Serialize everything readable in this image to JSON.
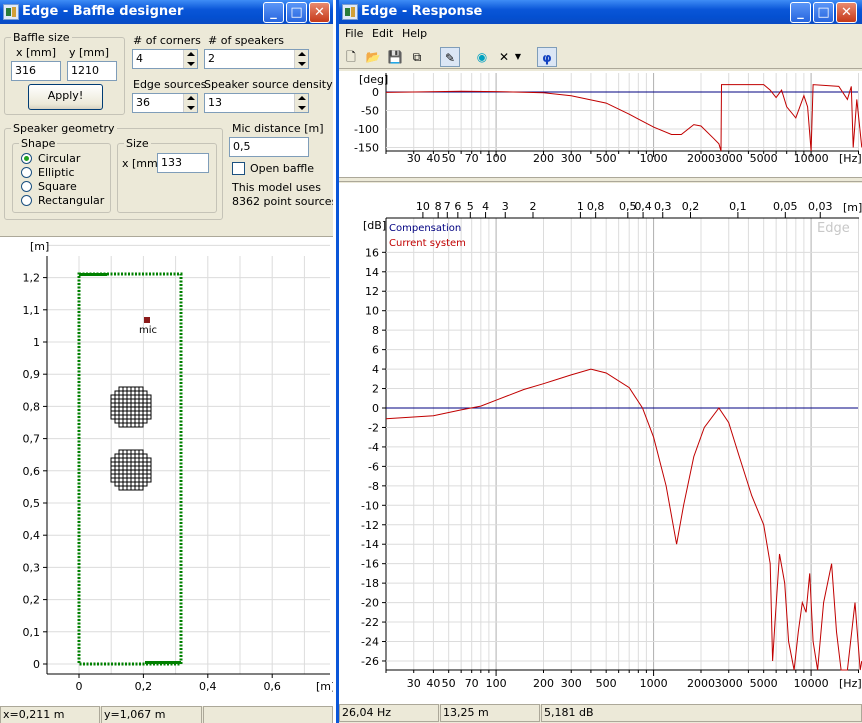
{
  "baffle_window": {
    "title": "Edge - Baffle designer",
    "baffle_size": {
      "group_label": "Baffle size",
      "x_label": "x [mm]",
      "y_label": "y [mm]",
      "x_value": "316",
      "y_value": "1210",
      "apply_label": "Apply!"
    },
    "corners": {
      "label": "# of corners",
      "value": "4"
    },
    "speakers": {
      "label": "# of speakers",
      "value": "2"
    },
    "edge_sources": {
      "label": "Edge sources",
      "value": "36"
    },
    "density": {
      "label": "Speaker source density",
      "value": "13"
    },
    "geometry": {
      "group_label": "Speaker geometry",
      "shape_label": "Shape",
      "shapes": [
        "Circular",
        "Elliptic",
        "Square",
        "Rectangular"
      ],
      "selected_shape": "Circular",
      "size_label": "Size",
      "size_x_label": "x [mm]",
      "size_x_value": "133"
    },
    "mic_distance": {
      "label": "Mic distance [m]",
      "value": "0,5"
    },
    "open_baffle": {
      "label": "Open baffle",
      "checked": false
    },
    "model_info": {
      "line1": "This model uses",
      "line2": "8362 point sources"
    },
    "plot": {
      "y_unit": "[m]",
      "x_unit": "[m]",
      "y_ticks": [
        "1,2",
        "1,1",
        "1",
        "0,9",
        "0,8",
        "0,7",
        "0,6",
        "0,5",
        "0,4",
        "0,3",
        "0,2",
        "0,1",
        "0"
      ],
      "x_ticks": [
        "0",
        "0,2",
        "0,4",
        "0,6"
      ],
      "mic_label": "mic",
      "baffle_color": "#008000",
      "speaker_color": "#000000",
      "mic_color": "#8b1a1a"
    },
    "status": {
      "x": "x=0,211 m",
      "y": "y=1,067 m"
    }
  },
  "response_window": {
    "title": "Edge - Response",
    "menu": [
      "File",
      "Edit",
      "Help"
    ],
    "toolbar_icons": [
      "new-icon",
      "open-icon",
      "save-icon",
      "copy-icon",
      "pencil-icon",
      "speaker-icon",
      "delete-icon",
      "dropdown-icon",
      "phi-icon"
    ],
    "phase_plot": {
      "y_unit": "[deg]",
      "y_ticks": [
        "0",
        "-50",
        "-100",
        "-150"
      ],
      "x_ticks": [
        "30",
        "40",
        "50",
        "70",
        "100",
        "200",
        "300",
        "500",
        "1000",
        "2000",
        "3000",
        "5000",
        "10000"
      ],
      "x_unit": "[Hz]"
    },
    "magnitude_plot": {
      "y_unit": "[dB]",
      "y_ticks": [
        "16",
        "14",
        "12",
        "10",
        "8",
        "6",
        "4",
        "2",
        "0",
        "-2",
        "-4",
        "-6",
        "-8",
        "-10",
        "-12",
        "-14",
        "-16",
        "-18",
        "-20",
        "-22",
        "-24",
        "-26"
      ],
      "x_ticks": [
        "30",
        "40",
        "50",
        "70",
        "100",
        "200",
        "300",
        "500",
        "1000",
        "2000",
        "3000",
        "5000",
        "10000"
      ],
      "x_unit": "[Hz]",
      "top_unit": "[m]",
      "top_ticks": [
        "10",
        "8",
        "7",
        "6",
        "5",
        "4",
        "3",
        "2",
        "1",
        "0,8",
        "0,5",
        "0,4",
        "0,3",
        "0,2",
        "0,1",
        "0,05",
        "0,03"
      ],
      "legend": [
        {
          "name": "Compensation",
          "color": "#000080"
        },
        {
          "name": "Current system",
          "color": "#c00000"
        }
      ],
      "watermark": "Edge"
    },
    "status": {
      "freq": "26,04 Hz",
      "dist": "13,25 m",
      "level": "5,181 dB"
    }
  }
}
